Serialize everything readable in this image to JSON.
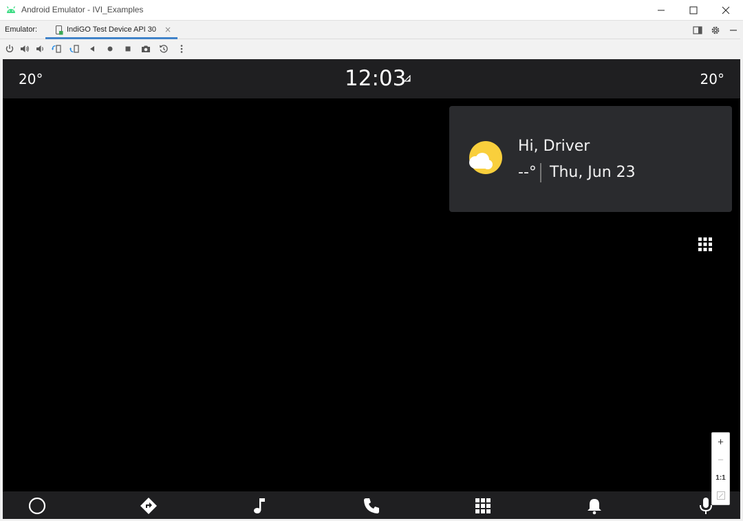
{
  "window": {
    "title": "Android Emulator - IVI_Examples"
  },
  "tabbar": {
    "label": "Emulator:",
    "tab_label": "IndiGO Test Device API 30",
    "tab_close": "×"
  },
  "screen": {
    "status": {
      "temp_left": "20°",
      "clock": "12:03",
      "temp_right": "20°"
    },
    "card": {
      "greeting": "Hi, Driver",
      "temperature": "--°",
      "date": "Thu, Jun 23"
    }
  },
  "zoom": {
    "plus": "+",
    "minus": "−",
    "one_to_one": "1:1"
  },
  "colors": {
    "accent": "#4083c9",
    "status_bg": "#1f1f21",
    "card_bg": "#2a2b2e",
    "sun": "#f9cf3c",
    "android_green": "#3ddc84"
  },
  "icons": {
    "toolbar": [
      "power-icon",
      "volume-up-icon",
      "volume-down-icon",
      "rotate-left-icon",
      "rotate-right-icon",
      "back-icon",
      "home-icon",
      "overview-icon",
      "camera-icon",
      "replay-icon",
      "more-icon"
    ],
    "nav": [
      "home-circle-icon",
      "navigation-icon",
      "music-icon",
      "phone-icon",
      "apps-icon",
      "bell-icon",
      "mic-icon"
    ]
  }
}
